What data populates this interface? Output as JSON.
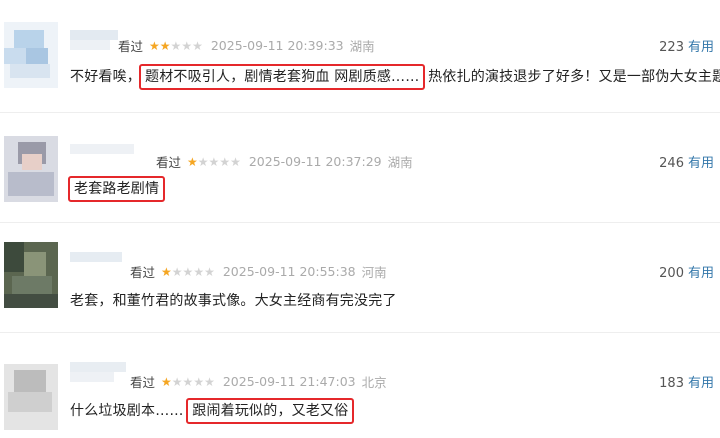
{
  "reviews": [
    {
      "watched": "看过",
      "stars": 2,
      "date": "2025-09-11 20:39:33",
      "location": "湖南",
      "count": "223",
      "useful": "有用",
      "text_before": "不好看唉，",
      "text_highlight": "题材不吸引人，剧情老套狗血 网剧质感……",
      "text_after": " 热依扎的演技退步了好多！又是一部伪大女主题材"
    },
    {
      "watched": "看过",
      "stars": 1,
      "date": "2025-09-11 20:37:29",
      "location": "湖南",
      "count": "246",
      "useful": "有用",
      "text_before": "",
      "text_highlight": "老套路老剧情",
      "text_after": ""
    },
    {
      "watched": "看过",
      "stars": 1,
      "date": "2025-09-11 20:55:38",
      "location": "河南",
      "count": "200",
      "useful": "有用",
      "text_before": "老套，和董竹君的故事式像。大女主经商有完没完了",
      "text_highlight": "",
      "text_after": ""
    },
    {
      "watched": "看过",
      "stars": 1,
      "date": "2025-09-11 21:47:03",
      "location": "北京",
      "count": "183",
      "useful": "有用",
      "text_before": "什么垃圾剧本…… ",
      "text_highlight": "跟闹着玩似的，又老又俗",
      "text_after": ""
    }
  ],
  "colors": {
    "star_on": "#f5a623",
    "star_off": "#d3d3d3",
    "highlight_border": "#e5282b",
    "useful_link": "#3377aa"
  }
}
